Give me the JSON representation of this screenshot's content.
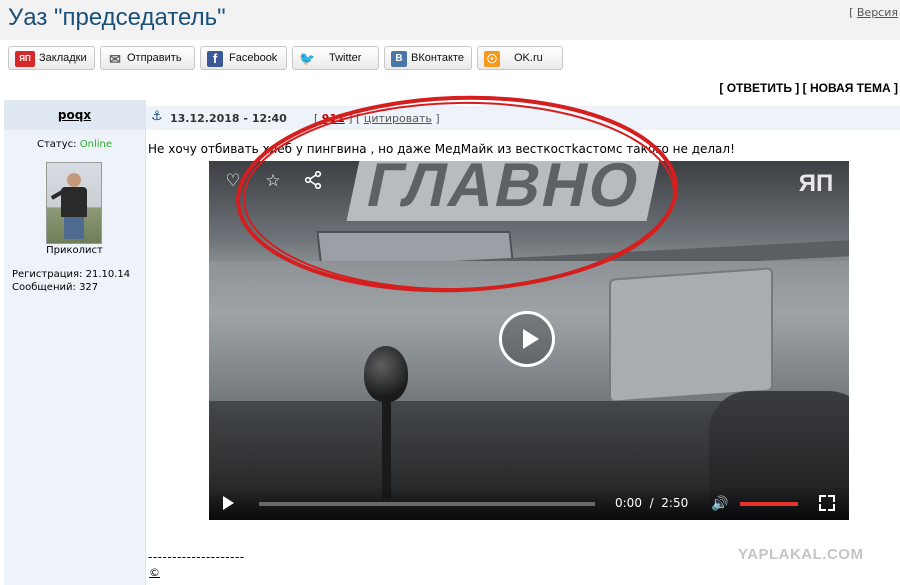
{
  "page": {
    "title": "Уаз \"председатель\"",
    "version_bracket_open": "[",
    "version_label": "Версия"
  },
  "share": [
    {
      "label": "Закладки",
      "icon": "yap-icon",
      "color": "#d62828",
      "glyph": "ЯП"
    },
    {
      "label": "Отправить",
      "icon": "envelope-icon",
      "color": "#ffffff",
      "glyph": "✉"
    },
    {
      "label": "Facebook",
      "icon": "facebook-icon",
      "color": "#3b5998",
      "glyph": "f"
    },
    {
      "label": "Twitter",
      "icon": "twitter-icon",
      "color": "#e6f5fb",
      "glyph": "t"
    },
    {
      "label": "ВКонтакте",
      "icon": "vk-icon",
      "color": "#4a76a8",
      "glyph": "В"
    },
    {
      "label": "OK.ru",
      "icon": "ok-icon",
      "color": "#f59a1c",
      "glyph": "o"
    }
  ],
  "actions": {
    "reply": "ОТВЕТИТЬ",
    "new_topic": "НОВАЯ ТЕМА"
  },
  "author": {
    "name": "poqx",
    "status_label": "Статус:",
    "status_value": "Online",
    "rank": "Приколист",
    "reg_label": "Регистрация:",
    "reg_value": "21.10.14",
    "msgs_label": "Сообщений:",
    "msgs_value": "327"
  },
  "post": {
    "anchor_icon": "anchor-icon",
    "date": "13.12.2018 - 12:40",
    "number": "911",
    "quote_label": "цитировать",
    "text": "Не хочу отбивать хлеб у пингвина , но даже МедМайк из весткостkастомс такого не делал!",
    "signature_line": "--------------------",
    "signature_mark": "©"
  },
  "video": {
    "sign_text": "ГЛАВНО",
    "logo": "ЯП",
    "current_time": "0:00",
    "separator": "/",
    "duration": "2:50",
    "progress": 0.0,
    "volume": 1.0,
    "highlight_color": "#d51f1f"
  },
  "watermark": "YAPLAKAL.COM"
}
